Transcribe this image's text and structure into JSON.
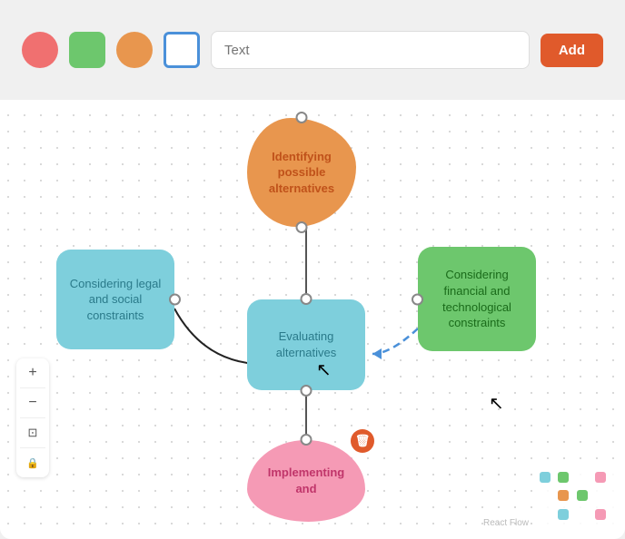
{
  "toolbar": {
    "text_placeholder": "Text",
    "add_label": "Add",
    "shapes": [
      {
        "name": "circle",
        "color": "#f07070"
      },
      {
        "name": "rounded-rect",
        "color": "#6dc76d"
      },
      {
        "name": "diamond",
        "color": "#e8964e"
      },
      {
        "name": "square",
        "color": "white"
      }
    ]
  },
  "nodes": {
    "identify": {
      "label": "Identifying possible alternatives"
    },
    "legal": {
      "label": "Considering legal and social constraints"
    },
    "financial": {
      "label": "Considering financial and technological constraints"
    },
    "evaluate": {
      "label": "Evaluating alternatives"
    },
    "implement": {
      "label": "Implementing and"
    }
  },
  "zoom": {
    "plus": "+",
    "minus": "−",
    "fit": "⊡",
    "lock": "🔒"
  },
  "branding": {
    "label": "React Flow"
  },
  "legend": {
    "colors": [
      "#7ecfdc",
      "#6dc76d",
      "#e8964e",
      "#f59ab5",
      "#7ecfdc",
      "#e8964e",
      "#6dc76d",
      "#f59ab5",
      "#7ecfdc",
      "#6dc76d",
      "#e8964e",
      "#f59ab5"
    ]
  }
}
